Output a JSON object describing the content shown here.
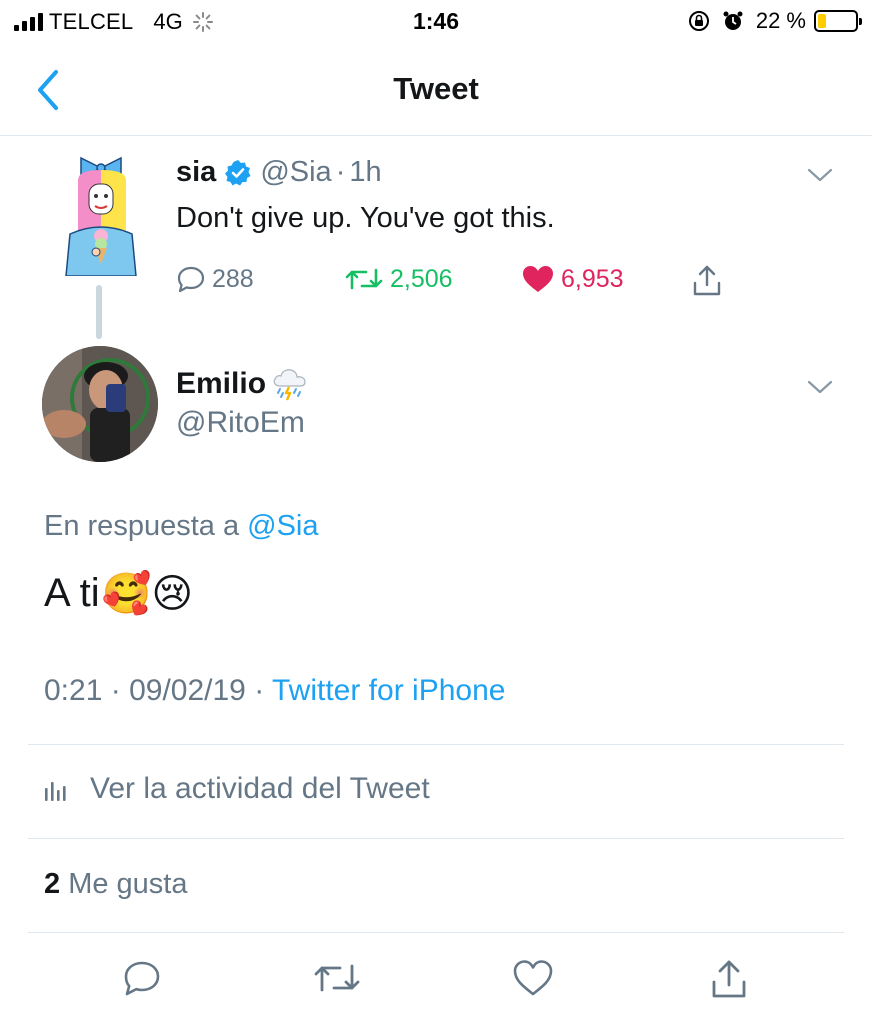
{
  "status_bar": {
    "carrier": "TELCEL",
    "network": "4G",
    "time": "1:46",
    "battery": "22 %",
    "battery_level": 0.22
  },
  "nav": {
    "title": "Tweet",
    "back_icon": "chevron-left-icon"
  },
  "parent_tweet": {
    "name": "sia",
    "handle": "@Sia",
    "dot": "·",
    "time": "1h",
    "text": "Don't give up. You've got this.",
    "replies": "288",
    "retweets": "2,506",
    "likes": "6,953",
    "colors": {
      "retweet": "#17bf63",
      "like": "#e0245e"
    }
  },
  "tweet": {
    "name": "Emilio",
    "handle": "@RitoEm",
    "reply_prefix": "En respuesta a",
    "reply_target": "@Sia",
    "text": "A ti",
    "emojis": "🥰😢",
    "time": "0:21",
    "date": "09/02/19",
    "source": "Twitter for iPhone",
    "sep": "·"
  },
  "activity": {
    "label": "Ver la actividad del Tweet"
  },
  "likes": {
    "count": "2",
    "label": "Me gusta"
  },
  "colors": {
    "accent": "#1da1f2",
    "muted": "#657786",
    "divider": "#e1e8ed"
  }
}
